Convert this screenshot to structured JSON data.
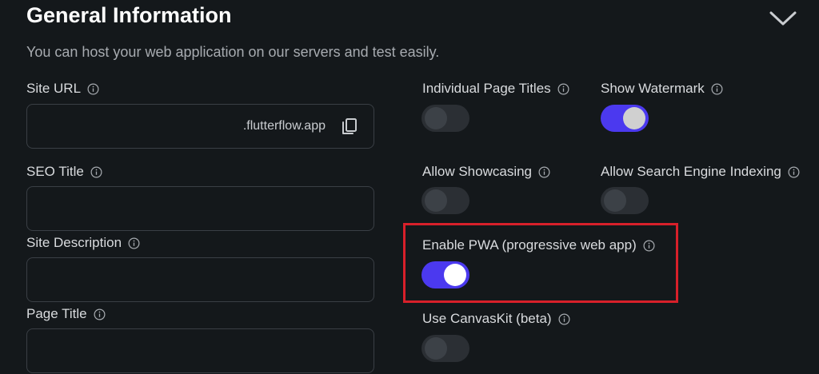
{
  "header": {
    "title": "General Information",
    "subtitle": "You can host your web application on our servers and test easily."
  },
  "fields": {
    "site_url": {
      "label": "Site URL",
      "value": "",
      "suffix": ".flutterflow.app"
    },
    "seo_title": {
      "label": "SEO Title",
      "value": ""
    },
    "site_description": {
      "label": "Site Description",
      "value": ""
    },
    "page_title": {
      "label": "Page Title",
      "value": ""
    }
  },
  "toggles": {
    "individual_page_titles": {
      "label": "Individual Page Titles",
      "on": false
    },
    "show_watermark": {
      "label": "Show Watermark",
      "on": true
    },
    "allow_showcasing": {
      "label": "Allow Showcasing",
      "on": false
    },
    "allow_search_engine_indexing": {
      "label": "Allow Search Engine Indexing",
      "on": false
    },
    "enable_pwa": {
      "label": "Enable PWA (progressive web app)",
      "on": true
    },
    "use_canvaskit": {
      "label": "Use CanvasKit (beta)",
      "on": false
    }
  },
  "colors": {
    "accent": "#4b39ef",
    "background": "#14181b",
    "highlight": "#d8202a"
  },
  "icons": {
    "info": "info-circle-icon",
    "copy": "copy-icon",
    "collapse": "chevron-down-icon"
  }
}
